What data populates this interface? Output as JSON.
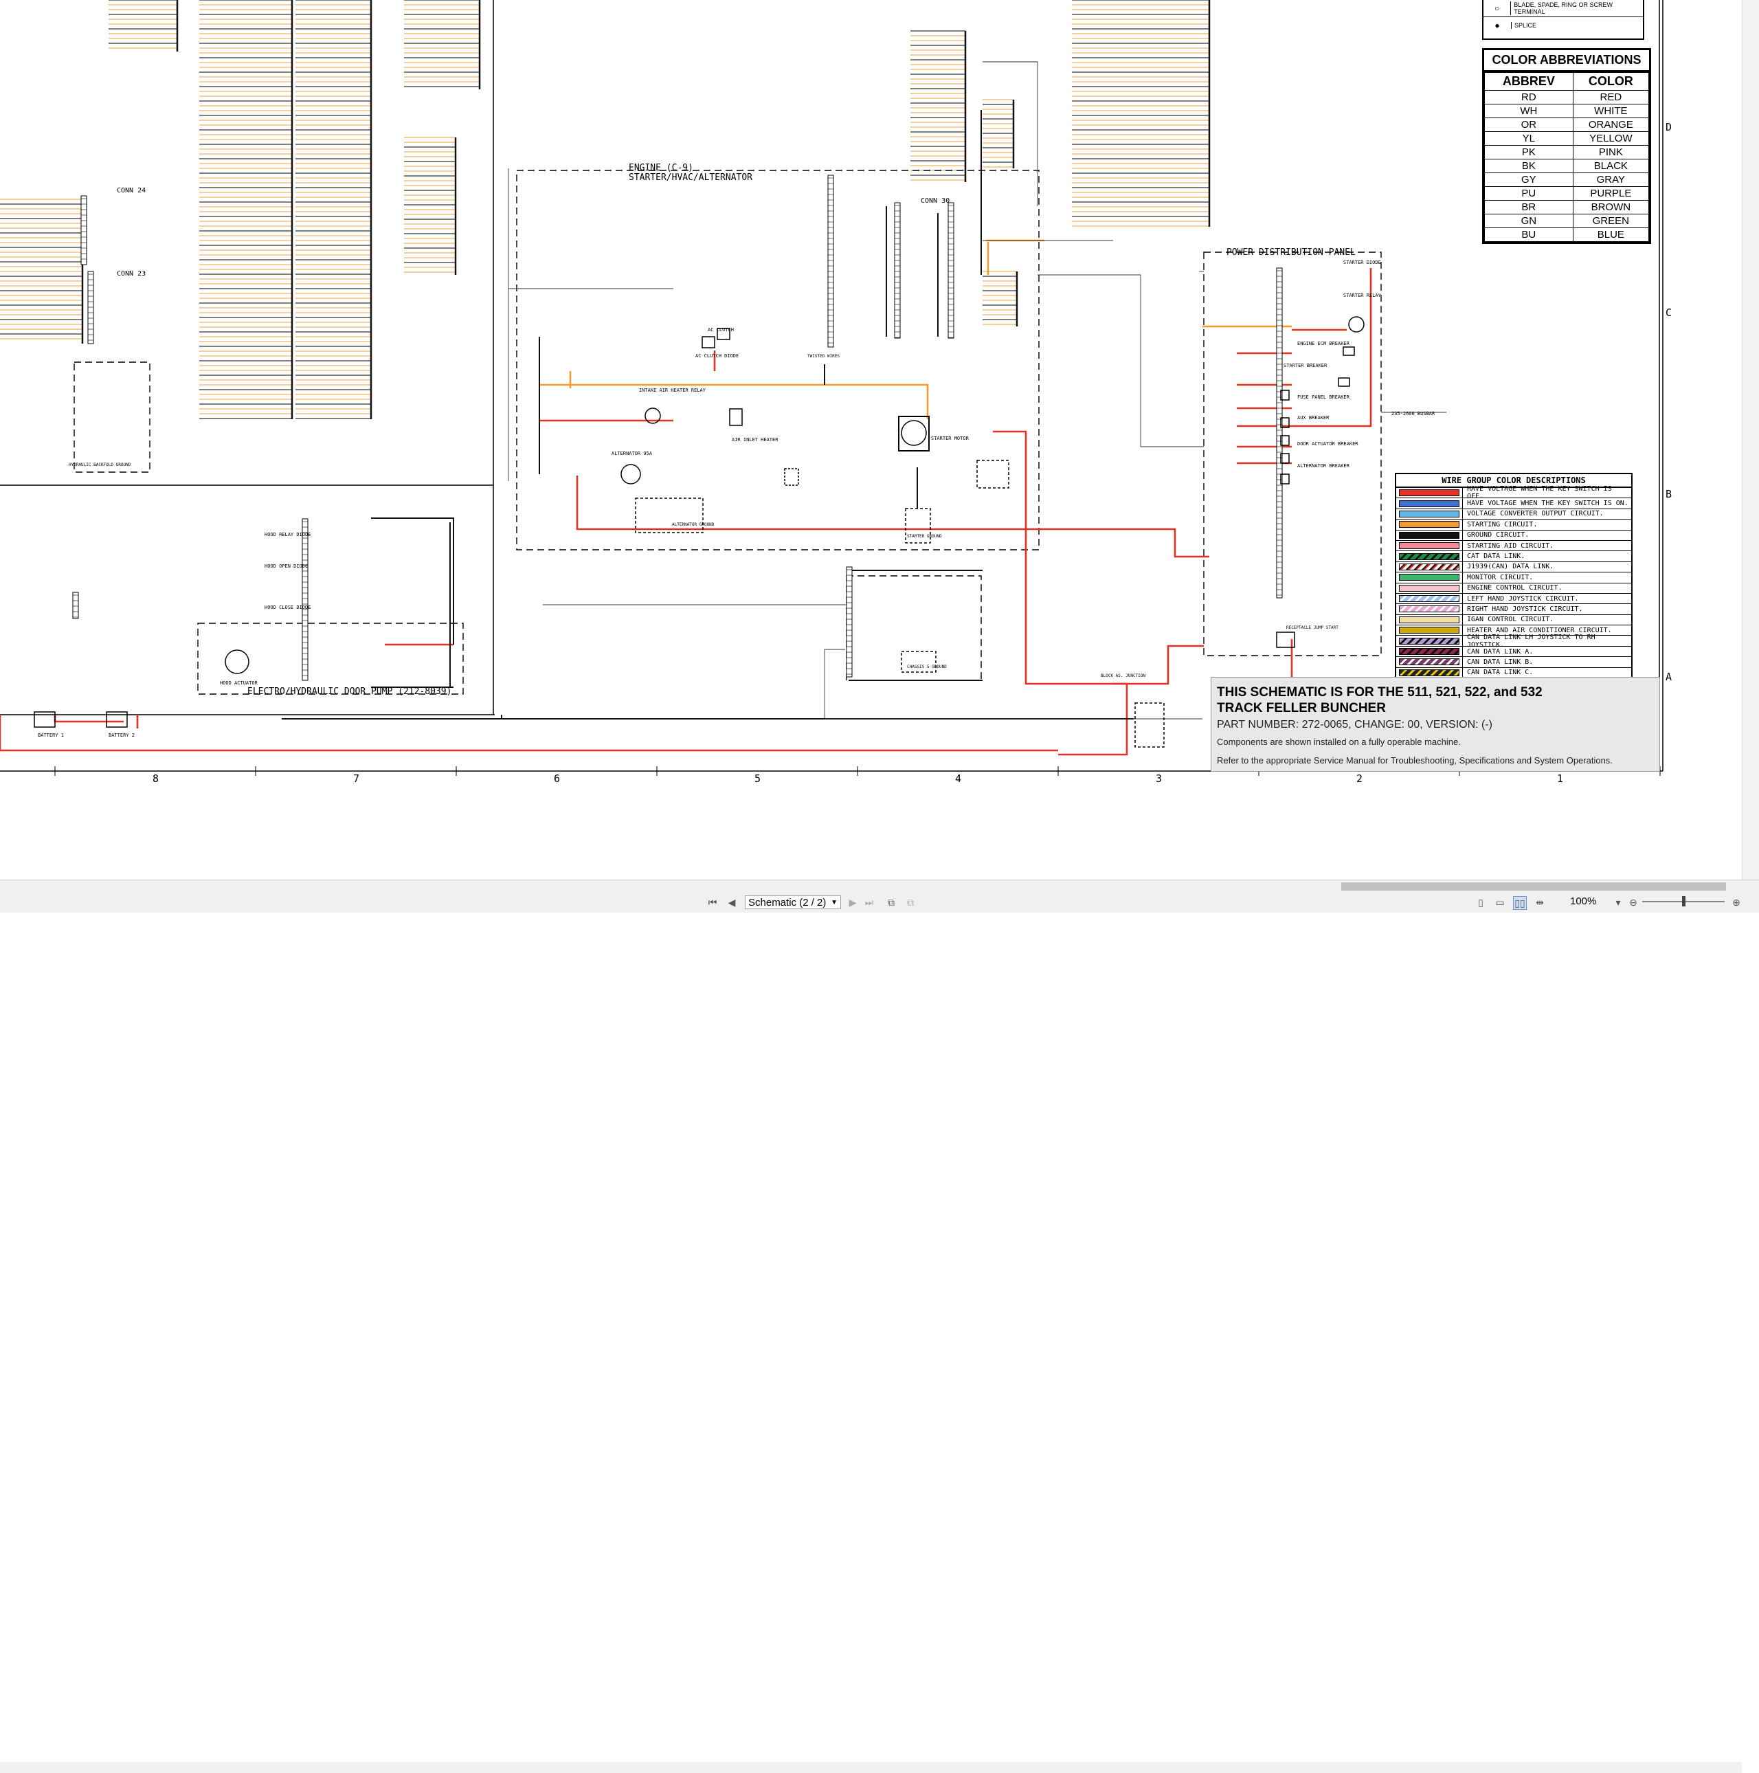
{
  "schematic": {
    "engine_title": "ENGINE (C-9)",
    "engine_subtitle": "STARTER/HVAC/ALTERNATOR",
    "pdp_title": "POWER DISTRIBUTION PANEL",
    "pump_title": "ELECTRO/HYDRAULIC DOOR PUMP (212-8039)",
    "conn24": "CONN 24",
    "conn23": "CONN 23",
    "conn30": "CONN 30",
    "alternator": "ALTERNATOR 95A",
    "starter_motor": "STARTER MOTOR",
    "air_inlet_heater": "AIR INLET HEATER",
    "alternator_ground": "ALTERNATOR GROUND",
    "starter_ground": "STARTER GROUND",
    "chassis_ground": "CHASSIS 5 GROUND",
    "hydraulic_backfold": "HYDRAULIC BACKFOLD GROUND",
    "ac_clutch": "AC CLUTCH",
    "ac_clutch_diode": "AC CLUTCH DIODE",
    "intake_air_heater_relay": "INTAKE AIR HEATER RELAY",
    "starter_diode": "STARTER DIODE",
    "starter_relay": "STARTER RELAY",
    "engine_ecm_breaker": "ENGINE ECM BREAKER",
    "starter_breaker": "STARTER BREAKER",
    "fuse_panel_breaker": "FUSE PANEL BREAKER",
    "aux_breaker": "AUX BREAKER",
    "door_actuator_breaker": "DOOR ACTUATOR BREAKER",
    "alternator_breaker": "ALTERNATOR BREAKER",
    "busbar": "235-2600 BUSBAR",
    "hood_relay_diode": "HOOD RELAY DIODE",
    "hood_open_diode": "HOOD OPEN DIODE",
    "hood_close_diode": "HOOD CLOSE DIODE",
    "hood_actuator": "HOOD ACTUATOR",
    "battery1": "BATTERY 1",
    "battery2": "BATTERY 2",
    "twisted_wires": "TWISTED WIRES",
    "receptacle": "RECEPTACLE JUMP START",
    "junction": "BLOCK AS. JUNCTION",
    "zone_cols": [
      "8",
      "7",
      "6",
      "5",
      "4",
      "3",
      "2",
      "1"
    ],
    "zone_rows": [
      "D",
      "C",
      "B",
      "A"
    ]
  },
  "terminal_legend": {
    "items": [
      "BLADE, SPADE, RING OR SCREW TERMINAL",
      "SPLICE"
    ]
  },
  "color_abbrev": {
    "title": "COLOR ABBREVIATIONS",
    "col1": "ABBREV",
    "col2": "COLOR",
    "rows": [
      [
        "RD",
        "RED"
      ],
      [
        "WH",
        "WHITE"
      ],
      [
        "OR",
        "ORANGE"
      ],
      [
        "YL",
        "YELLOW"
      ],
      [
        "PK",
        "PINK"
      ],
      [
        "BK",
        "BLACK"
      ],
      [
        "GY",
        "GRAY"
      ],
      [
        "PU",
        "PURPLE"
      ],
      [
        "BR",
        "BROWN"
      ],
      [
        "GN",
        "GREEN"
      ],
      [
        "BU",
        "BLUE"
      ]
    ]
  },
  "wire_groups": {
    "title": "WIRE GROUP COLOR DESCRIPTIONS",
    "rows": [
      {
        "label": "HAVE VOLTAGE WHEN THE KEY SWITCH IS OFF.",
        "color": "#e8312b",
        "pattern": "solid"
      },
      {
        "label": "HAVE VOLTAGE WHEN THE KEY SWITCH IS ON.",
        "color": "#3b6fd6",
        "pattern": "solid"
      },
      {
        "label": "VOLTAGE CONVERTER OUTPUT CIRCUIT.",
        "color": "#5fb8e6",
        "pattern": "solid"
      },
      {
        "label": "STARTING CIRCUIT.",
        "color": "#f29a2e",
        "pattern": "solid"
      },
      {
        "label": "GROUND CIRCUIT.",
        "color": "#111111",
        "pattern": "solid"
      },
      {
        "label": "STARTING AID CIRCUIT.",
        "color": "#f08a9a",
        "pattern": "solid"
      },
      {
        "label": "CAT DATA LINK.",
        "color": "#1f8a4a",
        "pattern": "stripe-dark"
      },
      {
        "label": "J1939(CAN) DATA LINK.",
        "color": "#bbbbbb",
        "pattern": "stripe-red"
      },
      {
        "label": "MONITOR CIRCUIT.",
        "color": "#3fb56a",
        "pattern": "solid"
      },
      {
        "label": "ENGINE CONTROL CIRCUIT.",
        "color": "#f5c6d0",
        "pattern": "solid"
      },
      {
        "label": "LEFT HAND JOYSTICK CIRCUIT.",
        "color": "#9fc3ea",
        "pattern": "stripe-light"
      },
      {
        "label": "RIGHT HAND JOYSTICK CIRCUIT.",
        "color": "#e8a8d6",
        "pattern": "stripe-light"
      },
      {
        "label": "IGAN CONTROL CIRCUIT.",
        "color": "#f3d9a6",
        "pattern": "solid"
      },
      {
        "label": "HEATER AND AIR CONDITIONER CIRCUIT.",
        "color": "#c9a800",
        "pattern": "solid"
      },
      {
        "label": "CAN DATA LINK LH JOYSTICK TO RH JOYSTICK.",
        "color": "#b39ddb",
        "pattern": "stripe-dark"
      },
      {
        "label": "CAN DATA LINK A.",
        "color": "#8a2a4a",
        "pattern": "stripe-dark"
      },
      {
        "label": "CAN DATA LINK B.",
        "color": "#7a3a6a",
        "pattern": "stripe-light"
      },
      {
        "label": "CAN DATA LINK C.",
        "color": "#333333",
        "pattern": "stripe-yellow"
      }
    ]
  },
  "title_block": {
    "line1": "THIS SCHEMATIC IS FOR THE 511, 521, 522, and 532",
    "line2": "TRACK FELLER BUNCHER",
    "part": "PART NUMBER: 272-0065, CHANGE: 00, VERSION: (-)",
    "note1": "Components are shown installed on a fully operable machine.",
    "note2": "Refer to the appropriate Service Manual for Troubleshooting, Specifications and System Operations."
  },
  "statusbar": {
    "page_select": "Schematic (2 / 2)",
    "zoom": "100%"
  }
}
